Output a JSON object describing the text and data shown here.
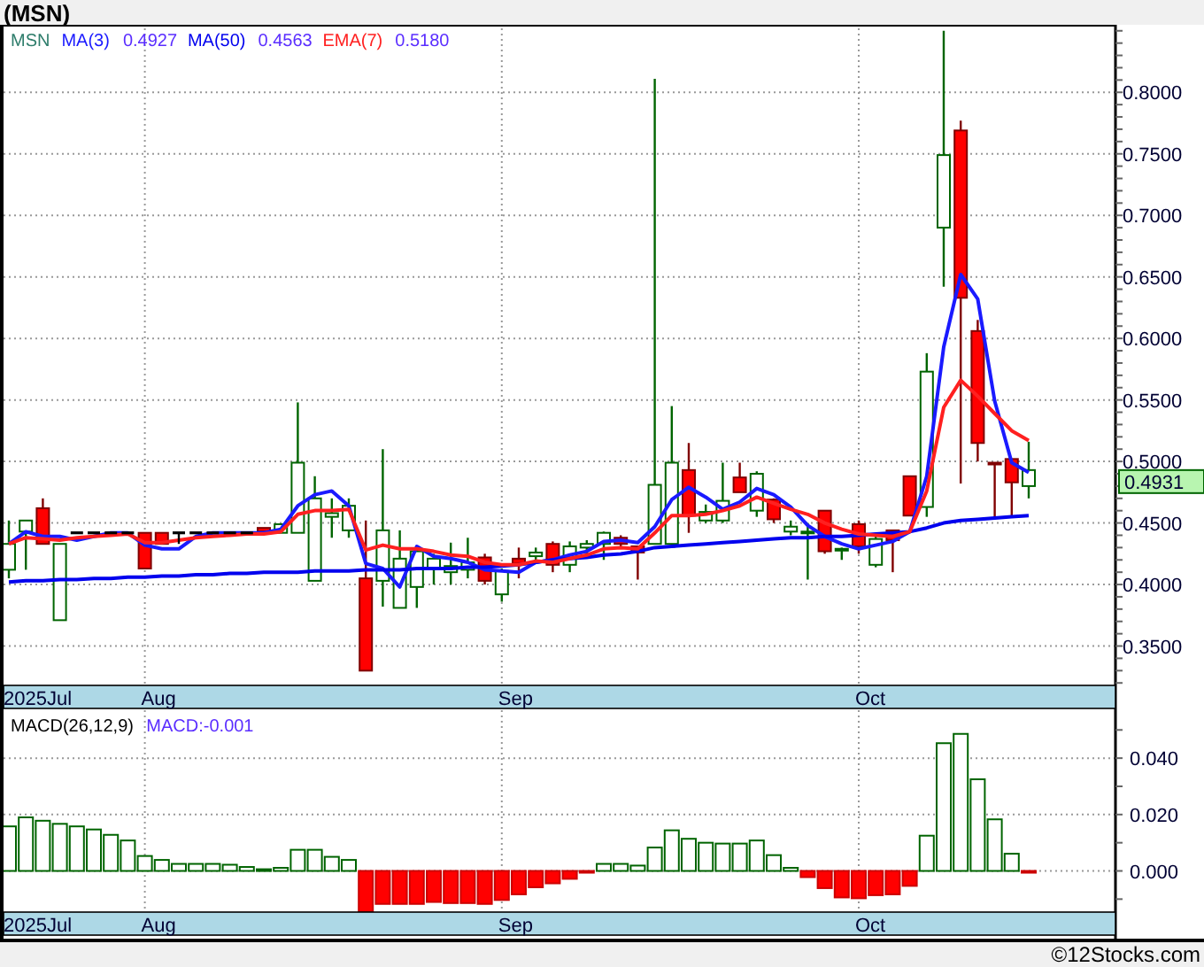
{
  "title": "(MSN)",
  "price_panel": {
    "last_price": "0.4931",
    "date_axis": [
      {
        "label": "2025Jul"
      },
      {
        "label": "Aug"
      },
      {
        "label": "Sep"
      },
      {
        "label": "Oct"
      }
    ],
    "legend_values": [
      "0.4927",
      "0.4563",
      "0.5180"
    ],
    "chart_data": {
      "type": "candlestick",
      "title": "MSN",
      "grid": true,
      "ylim": [
        0.318,
        0.852
      ],
      "yticks": [
        {
          "value": 0.35,
          "label": "0.3500"
        },
        {
          "value": 0.4,
          "label": "0.4000"
        },
        {
          "value": 0.45,
          "label": "0.4500"
        },
        {
          "value": 0.5,
          "label": "0.5000"
        },
        {
          "value": 0.55,
          "label": "0.5500"
        },
        {
          "value": 0.6,
          "label": "0.6000"
        },
        {
          "value": 0.65,
          "label": "0.6500"
        },
        {
          "value": 0.7,
          "label": "0.7000"
        },
        {
          "value": 0.75,
          "label": "0.7500"
        },
        {
          "value": 0.8,
          "label": "0.8000"
        }
      ],
      "ohlc": [
        [
          0.412,
          0.452,
          0.405,
          0.433
        ],
        [
          0.443,
          0.452,
          0.412,
          0.452
        ],
        [
          0.462,
          0.47,
          0.433,
          0.433
        ],
        [
          0.371,
          0.433,
          0.371,
          0.433
        ],
        [
          0.442,
          0.442,
          0.442,
          0.442
        ],
        [
          0.442,
          0.442,
          0.442,
          0.442
        ],
        [
          0.442,
          0.442,
          0.442,
          0.442
        ],
        [
          0.442,
          0.442,
          0.442,
          0.442
        ],
        [
          0.442,
          0.442,
          0.413,
          0.413
        ],
        [
          0.442,
          0.442,
          0.433,
          0.433
        ],
        [
          0.442,
          0.442,
          0.433,
          0.442
        ],
        [
          0.442,
          0.442,
          0.442,
          0.442
        ],
        [
          0.442,
          0.442,
          0.442,
          0.442
        ],
        [
          0.442,
          0.442,
          0.442,
          0.442
        ],
        [
          0.442,
          0.442,
          0.442,
          0.442
        ],
        [
          0.446,
          0.446,
          0.443,
          0.443
        ],
        [
          0.442,
          0.449,
          0.442,
          0.449
        ],
        [
          0.442,
          0.548,
          0.442,
          0.499
        ],
        [
          0.403,
          0.488,
          0.403,
          0.47
        ],
        [
          0.455,
          0.47,
          0.438,
          0.458
        ],
        [
          0.444,
          0.47,
          0.438,
          0.464
        ],
        [
          0.405,
          0.452,
          0.33,
          0.33
        ],
        [
          0.403,
          0.51,
          0.382,
          0.444
        ],
        [
          0.381,
          0.444,
          0.381,
          0.421
        ],
        [
          0.398,
          0.43,
          0.381,
          0.427
        ],
        [
          0.413,
          0.425,
          0.4,
          0.421
        ],
        [
          0.41,
          0.434,
          0.4,
          0.415
        ],
        [
          0.412,
          0.438,
          0.405,
          0.418
        ],
        [
          0.422,
          0.425,
          0.4,
          0.403
        ],
        [
          0.392,
          0.413,
          0.386,
          0.411
        ],
        [
          0.421,
          0.43,
          0.405,
          0.417
        ],
        [
          0.423,
          0.43,
          0.42,
          0.426
        ],
        [
          0.433,
          0.435,
          0.41,
          0.416
        ],
        [
          0.416,
          0.435,
          0.41,
          0.431
        ],
        [
          0.43,
          0.436,
          0.425,
          0.433
        ],
        [
          0.433,
          0.443,
          0.42,
          0.442
        ],
        [
          0.438,
          0.44,
          0.43,
          0.433
        ],
        [
          0.431,
          0.431,
          0.404,
          0.426
        ],
        [
          0.433,
          0.811,
          0.433,
          0.481
        ],
        [
          0.433,
          0.545,
          0.433,
          0.499
        ],
        [
          0.493,
          0.515,
          0.442,
          0.456
        ],
        [
          0.452,
          0.465,
          0.45,
          0.459
        ],
        [
          0.452,
          0.499,
          0.45,
          0.468
        ],
        [
          0.487,
          0.499,
          0.475,
          0.475
        ],
        [
          0.46,
          0.492,
          0.455,
          0.49
        ],
        [
          0.469,
          0.47,
          0.45,
          0.453
        ],
        [
          0.443,
          0.452,
          0.44,
          0.447
        ],
        [
          0.442,
          0.45,
          0.404,
          0.443
        ],
        [
          0.46,
          0.46,
          0.425,
          0.427
        ],
        [
          0.428,
          0.43,
          0.42,
          0.429
        ],
        [
          0.449,
          0.452,
          0.425,
          0.431
        ],
        [
          0.416,
          0.44,
          0.414,
          0.437
        ],
        [
          0.444,
          0.444,
          0.41,
          0.436
        ],
        [
          0.488,
          0.488,
          0.456,
          0.456
        ],
        [
          0.463,
          0.588,
          0.455,
          0.573
        ],
        [
          0.69,
          0.85,
          0.642,
          0.749
        ],
        [
          0.769,
          0.777,
          0.482,
          0.633
        ],
        [
          0.606,
          0.615,
          0.5,
          0.515
        ],
        [
          0.499,
          0.499,
          0.453,
          0.498
        ],
        [
          0.502,
          0.502,
          0.454,
          0.483
        ],
        [
          0.48,
          0.516,
          0.47,
          0.493
        ]
      ],
      "series": [
        {
          "name": "MA(3)",
          "type": "line",
          "color": "#1a1aff",
          "values": [
            0.433,
            0.443,
            0.439,
            0.439,
            0.436,
            0.439,
            0.442,
            0.442,
            0.432,
            0.429,
            0.429,
            0.439,
            0.442,
            0.442,
            0.442,
            0.442,
            0.445,
            0.464,
            0.473,
            0.476,
            0.464,
            0.417,
            0.413,
            0.398,
            0.431,
            0.423,
            0.421,
            0.418,
            0.412,
            0.411,
            0.41,
            0.418,
            0.42,
            0.424,
            0.427,
            0.435,
            0.436,
            0.434,
            0.447,
            0.469,
            0.479,
            0.471,
            0.461,
            0.467,
            0.478,
            0.473,
            0.463,
            0.448,
            0.439,
            0.433,
            0.429,
            0.432,
            0.435,
            0.443,
            0.488,
            0.593,
            0.652,
            0.632,
            0.549,
            0.499,
            0.491
          ]
        },
        {
          "name": "MA(50)",
          "type": "line",
          "color": "#0000ee",
          "values": [
            0.402,
            0.403,
            0.403,
            0.404,
            0.404,
            0.405,
            0.405,
            0.406,
            0.406,
            0.407,
            0.407,
            0.408,
            0.408,
            0.409,
            0.409,
            0.41,
            0.41,
            0.41,
            0.411,
            0.411,
            0.411,
            0.412,
            0.412,
            0.412,
            0.413,
            0.413,
            0.413,
            0.414,
            0.414,
            0.415,
            0.416,
            0.418,
            0.42,
            0.421,
            0.422,
            0.424,
            0.425,
            0.427,
            0.43,
            0.431,
            0.432,
            0.433,
            0.434,
            0.435,
            0.436,
            0.437,
            0.438,
            0.438,
            0.439,
            0.439,
            0.44,
            0.441,
            0.442,
            0.443,
            0.446,
            0.45,
            0.452,
            0.453,
            0.454,
            0.455,
            0.456
          ]
        },
        {
          "name": "EMA(7)",
          "type": "line",
          "color": "#ff2020",
          "values": [
            0.433,
            0.438,
            0.437,
            0.436,
            0.438,
            0.439,
            0.44,
            0.441,
            0.434,
            0.434,
            0.436,
            0.438,
            0.439,
            0.44,
            0.441,
            0.441,
            0.443,
            0.457,
            0.46,
            0.46,
            0.461,
            0.428,
            0.432,
            0.429,
            0.429,
            0.427,
            0.424,
            0.423,
            0.418,
            0.416,
            0.416,
            0.419,
            0.418,
            0.421,
            0.424,
            0.429,
            0.43,
            0.429,
            0.442,
            0.456,
            0.456,
            0.457,
            0.46,
            0.464,
            0.471,
            0.466,
            0.461,
            0.457,
            0.45,
            0.445,
            0.441,
            0.44,
            0.439,
            0.443,
            0.476,
            0.544,
            0.566,
            0.553,
            0.539,
            0.525,
            0.517
          ]
        }
      ]
    }
  },
  "macd_panel": {
    "reading": "MACD:-0.001",
    "date_axis": [
      {
        "label": "2025Jul"
      },
      {
        "label": "Aug"
      },
      {
        "label": "Sep"
      },
      {
        "label": "Oct"
      }
    ],
    "chart_data": {
      "type": "bar",
      "grid": true,
      "ylim": [
        -0.0146,
        0.057
      ],
      "yticks": [
        {
          "value": 0,
          "label": "0.000"
        },
        {
          "value": 0.02,
          "label": "0.020"
        },
        {
          "value": 0.04,
          "label": "0.040"
        }
      ],
      "series": [
        {
          "name": "MACD(26,12,9)",
          "values": [
            0.0158,
            0.019,
            0.0178,
            0.0167,
            0.0158,
            0.0147,
            0.0128,
            0.0108,
            0.0053,
            0.0039,
            0.0025,
            0.0025,
            0.0025,
            0.0022,
            0.0014,
            0.0006,
            0.0011,
            0.0075,
            0.0075,
            0.005,
            0.0039,
            -0.0145,
            -0.0117,
            -0.0117,
            -0.0117,
            -0.011,
            -0.0114,
            -0.0114,
            -0.0117,
            -0.0103,
            -0.0083,
            -0.0058,
            -0.0044,
            -0.0028,
            -0.0006,
            0.0025,
            0.0025,
            0.0019,
            0.0083,
            0.0144,
            0.0114,
            0.01,
            0.0097,
            0.0097,
            0.0108,
            0.0056,
            0.0011,
            -0.0022,
            -0.0061,
            -0.0094,
            -0.0097,
            -0.0086,
            -0.0083,
            -0.0053,
            0.0125,
            0.0453,
            0.0486,
            0.0325,
            0.0183,
            0.0061,
            -0.0006
          ]
        }
      ]
    }
  },
  "footer": "©12Stocks.com"
}
